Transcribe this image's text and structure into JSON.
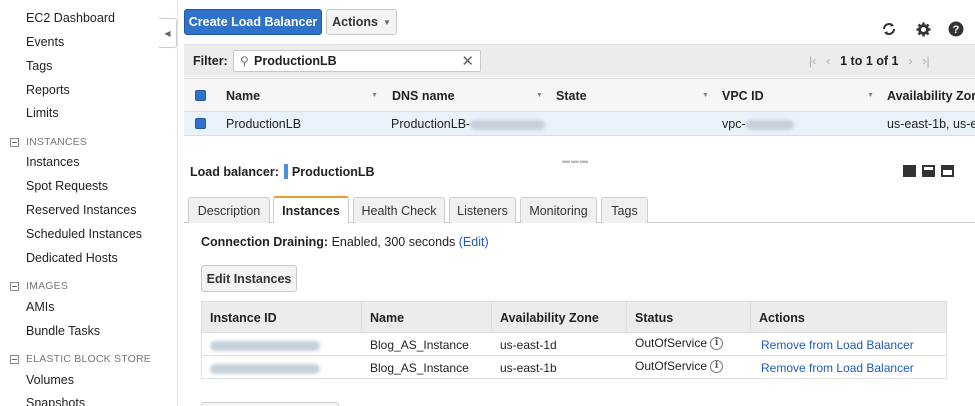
{
  "sidebar": {
    "items_top": [
      {
        "label": "EC2 Dashboard"
      },
      {
        "label": "Events"
      },
      {
        "label": "Tags"
      },
      {
        "label": "Reports"
      },
      {
        "label": "Limits"
      }
    ],
    "sections": [
      {
        "title": "INSTANCES",
        "items": [
          "Instances",
          "Spot Requests",
          "Reserved Instances",
          "Scheduled Instances",
          "Dedicated Hosts"
        ]
      },
      {
        "title": "IMAGES",
        "items": [
          "AMIs",
          "Bundle Tasks"
        ]
      },
      {
        "title": "ELASTIC BLOCK STORE",
        "items": [
          "Volumes",
          "Snapshots"
        ]
      }
    ]
  },
  "toolbar": {
    "create_label": "Create Load Balancer",
    "actions_label": "Actions",
    "icons": [
      "refresh-icon",
      "gear-icon",
      "help-icon"
    ]
  },
  "filter": {
    "label": "Filter:",
    "value": "ProductionLB",
    "pager_text": "1 to 1 of 1"
  },
  "grid": {
    "columns": [
      "Name",
      "DNS name",
      "State",
      "VPC ID",
      "Availability Zones"
    ],
    "columns_visible": [
      "Name",
      "DNS name",
      "State",
      "VPC ID",
      "Availability Zor"
    ],
    "row": {
      "name": "ProductionLB",
      "dns_name": "ProductionLB-",
      "state": "",
      "vpc_id": "vpc-",
      "zones": "us-east-1b, us-e"
    }
  },
  "details": {
    "title_key": "Load balancer:",
    "title_value": "ProductionLB",
    "tabs": [
      "Description",
      "Instances",
      "Health Check",
      "Listeners",
      "Monitoring",
      "Tags"
    ],
    "active_tab": "Instances",
    "connection_draining_key": "Connection Draining:",
    "connection_draining_value": "Enabled, 300 seconds",
    "edit_link": "(Edit)",
    "edit_instances_label": "Edit Instances"
  },
  "instances_table": {
    "headers": [
      "Instance ID",
      "Name",
      "Availability Zone",
      "Status",
      "Actions"
    ],
    "rows": [
      {
        "instance_id": "",
        "name": "Blog_AS_Instance",
        "zone": "us-east-1d",
        "status": "OutOfService",
        "action": "Remove from Load Balancer"
      },
      {
        "instance_id": "",
        "name": "Blog_AS_Instance",
        "zone": "us-east-1b",
        "status": "OutOfService",
        "action": "Remove from Load Balancer"
      }
    ]
  },
  "colors": {
    "primary_button": "#2e73c9",
    "link": "#1f5ac0",
    "active_tab_accent": "#e99d2c",
    "selected_row": "#e9f1fb"
  }
}
